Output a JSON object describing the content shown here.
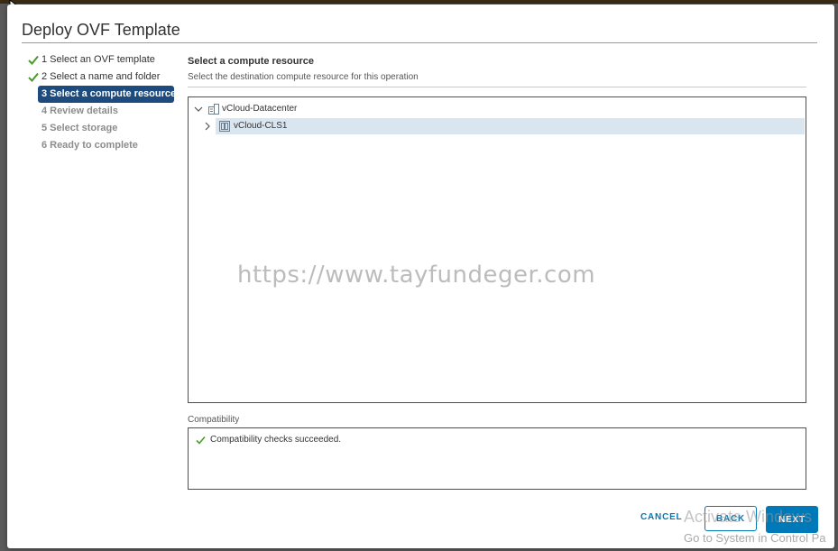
{
  "dialog": {
    "title": "Deploy OVF Template"
  },
  "steps": [
    {
      "num": "1",
      "label": "Select an OVF template",
      "state": "done"
    },
    {
      "num": "2",
      "label": "Select a name and folder",
      "state": "done"
    },
    {
      "num": "3",
      "label": "Select a compute resource",
      "state": "active"
    },
    {
      "num": "4",
      "label": "Review details",
      "state": "pending"
    },
    {
      "num": "5",
      "label": "Select storage",
      "state": "pending"
    },
    {
      "num": "6",
      "label": "Ready to complete",
      "state": "pending"
    }
  ],
  "section": {
    "title": "Select a compute resource",
    "subtitle": "Select the destination compute resource for this operation"
  },
  "tree": {
    "datacenter": {
      "label": "vCloud-Datacenter",
      "icon": "datacenter-icon",
      "expanded": true
    },
    "cluster": {
      "label": "vCloud-CLS1",
      "icon": "cluster-icon",
      "expanded": false,
      "selected": true
    }
  },
  "watermark": "https://www.tayfundeger.com",
  "compatibility": {
    "label": "Compatibility",
    "message": "Compatibility checks succeeded."
  },
  "buttons": {
    "cancel": "CANCEL",
    "back": "BACK",
    "next": "NEXT"
  },
  "os_overlay": {
    "activate": "Activate Windows",
    "goto": "Go to System in Control Pa"
  },
  "colors": {
    "accent": "#0079b8",
    "active_step": "#1d4b7e",
    "success": "#4a9a2c",
    "selection": "#d9e5ef"
  }
}
